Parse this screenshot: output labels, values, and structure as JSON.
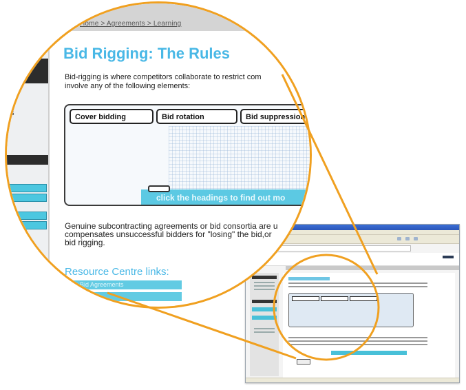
{
  "breadcrumb": "Home > Agreements > Learning",
  "page": {
    "title": "Bid Rigging: The Rules",
    "intro_line1": "Bid-rigging is where competitors collaborate to restrict com",
    "intro_line2": "involve any of the following elements:",
    "genuine_line1": "Genuine subcontracting agreements or bid consortia are u",
    "genuine_line2": "compensates unsuccessful bidders for \"losing\" the bid,or",
    "genuine_line3": "bid rigging."
  },
  "tabs": [
    {
      "label": "Cover bidding"
    },
    {
      "label": "Bid rotation"
    },
    {
      "label": "Bid suppression"
    }
  ],
  "instruction": "click the headings to find out mo",
  "sidebar": {
    "partial_text": "ds"
  },
  "resource_centre": {
    "heading": "Resource Centre links:",
    "links": [
      {
        "label": "... Bid Agreements"
      },
      {
        "label": "... "
      }
    ]
  },
  "colors": {
    "magnifier_ring": "#f0a020",
    "accent_cyan": "#4cc7e0",
    "title_blue": "#49b8e6"
  }
}
